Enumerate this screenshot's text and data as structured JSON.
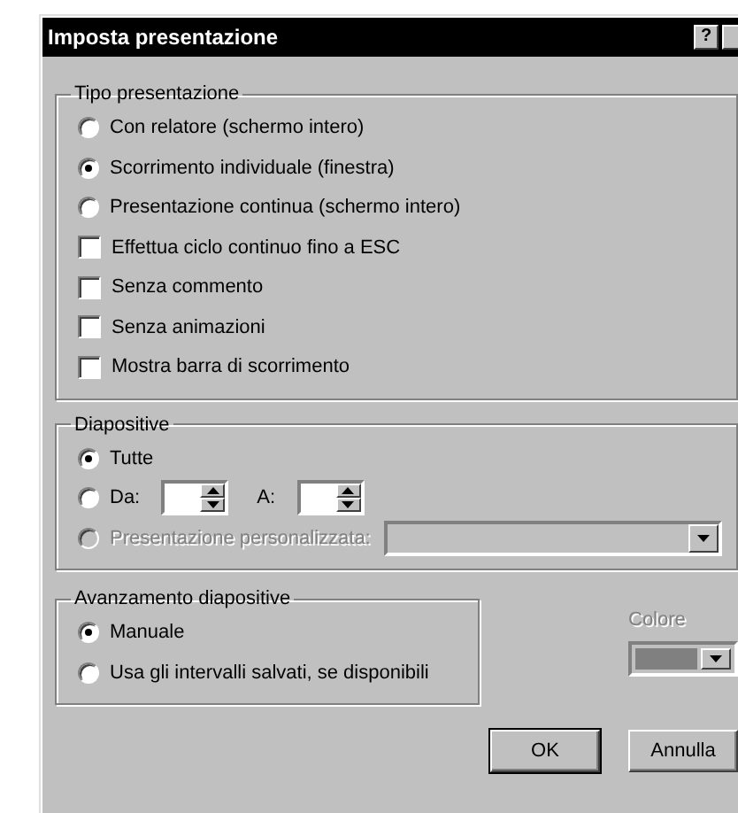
{
  "window": {
    "title": "Imposta presentazione",
    "help": "?"
  },
  "show_type": {
    "title": "Tipo presentazione",
    "options": [
      {
        "kind": "radio",
        "label": "Con relatore (schermo intero)",
        "selected": false
      },
      {
        "kind": "radio",
        "label": "Scorrimento individuale (finestra)",
        "selected": true
      },
      {
        "kind": "radio",
        "label": "Presentazione continua (schermo intero)",
        "selected": false
      },
      {
        "kind": "checkbox",
        "label": "Effettua ciclo continuo fino a ESC",
        "checked": false
      },
      {
        "kind": "checkbox",
        "label": "Senza commento",
        "checked": false
      },
      {
        "kind": "checkbox",
        "label": "Senza animazioni",
        "checked": false
      },
      {
        "kind": "checkbox",
        "label": "Mostra barra di scorrimento",
        "checked": false
      }
    ]
  },
  "slides": {
    "title": "Diapositive",
    "options": [
      {
        "kind": "radio",
        "label": "Tutte",
        "selected": true
      },
      {
        "kind": "range",
        "label": "Da:",
        "to_label": "A:",
        "selected": false
      },
      {
        "kind": "custom",
        "label": "Presentazione personalizzata:",
        "selected": false,
        "disabled": true
      }
    ]
  },
  "advance": {
    "title": "Avanzamento diapositive",
    "options": [
      {
        "kind": "radio",
        "label": "Manuale",
        "selected": true
      },
      {
        "kind": "radio",
        "label": "Usa gli intervalli salvati, se disponibili",
        "selected": false
      }
    ]
  },
  "pen_color": {
    "label": "Colore",
    "disabled": true
  },
  "buttons": [
    {
      "label": "OK",
      "default": true
    },
    {
      "label": "Annulla",
      "default": false
    }
  ]
}
